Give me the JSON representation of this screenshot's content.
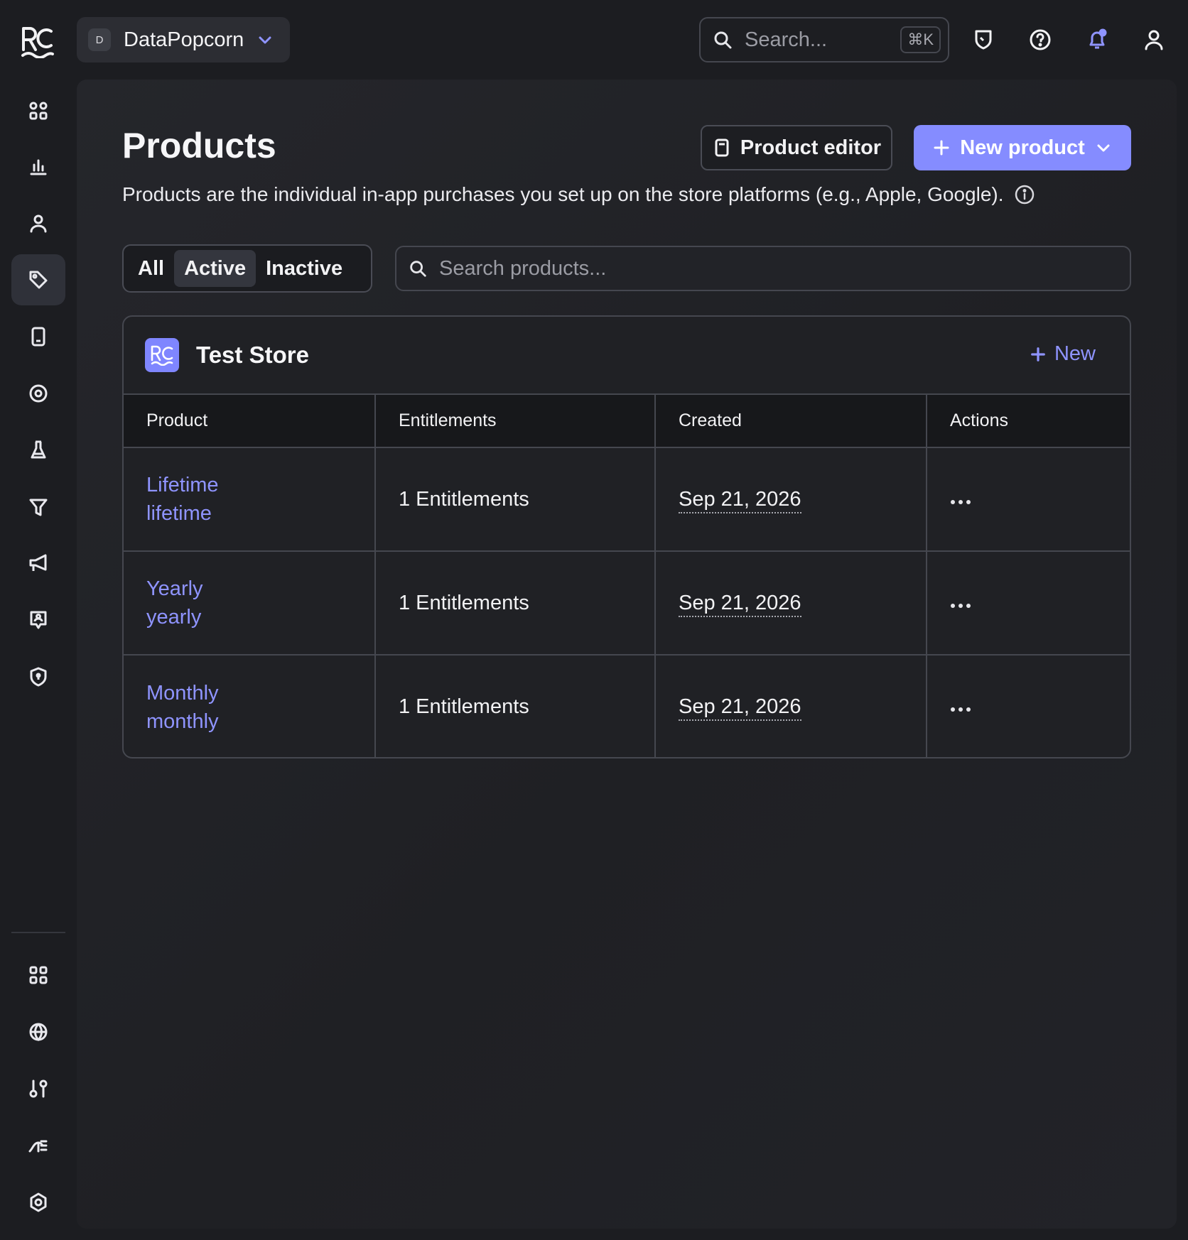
{
  "app": {
    "project": {
      "avatar_letter": "D",
      "name": "DataPopcorn"
    },
    "search": {
      "placeholder": "Search...",
      "shortcut": "⌘K"
    },
    "accent_color": "#858cff"
  },
  "page": {
    "title": "Products",
    "subtitle": "Products are the individual in-app purchases you set up on the store platforms (e.g., Apple, Google).",
    "product_editor_label": "Product editor",
    "new_product_label": "New product",
    "filter_tabs": [
      "All",
      "Active",
      "Inactive"
    ],
    "selected_filter": "Active",
    "search_placeholder": "Search products..."
  },
  "store": {
    "name": "Test Store",
    "new_label": "New",
    "columns": [
      "Product",
      "Entitlements",
      "Created",
      "Actions"
    ],
    "rows": [
      {
        "name": "Lifetime",
        "identifier": "lifetime",
        "entitlements": "1 Entitlements",
        "created": "Sep 21, 2026"
      },
      {
        "name": "Yearly",
        "identifier": "yearly",
        "entitlements": "1 Entitlements",
        "created": "Sep 21, 2026"
      },
      {
        "name": "Monthly",
        "identifier": "monthly",
        "entitlements": "1 Entitlements",
        "created": "Sep 21, 2026"
      }
    ]
  },
  "icons": {
    "sidebar_top": [
      "overview-icon",
      "charts-icon",
      "customers-icon",
      "products-tag-icon",
      "paywall-icon",
      "targeting-icon",
      "experiments-icon",
      "funnel-icon",
      "campaigns-icon",
      "customer-center-icon",
      "privacy-shield-icon"
    ],
    "sidebar_bottom": [
      "apps-grid-icon",
      "globe-icon",
      "integrations-icon",
      "webhooks-icon",
      "settings-icon"
    ],
    "topbar": [
      "shield-icon",
      "help-icon",
      "notifications-bell-icon",
      "account-icon"
    ]
  }
}
